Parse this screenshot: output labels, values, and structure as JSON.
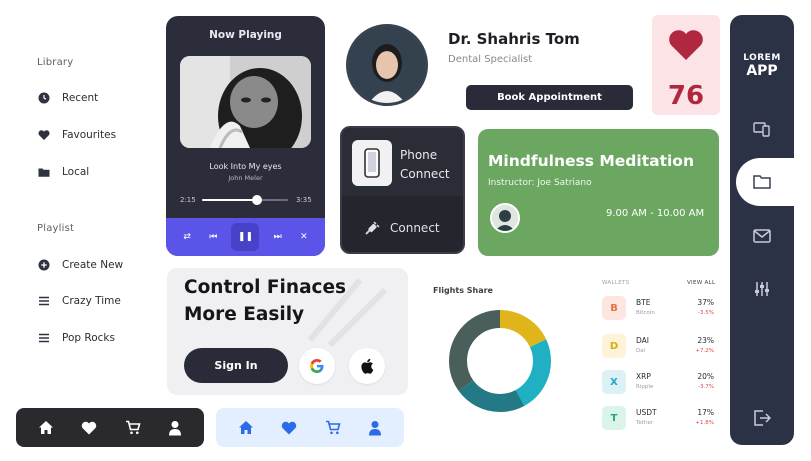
{
  "library": {
    "heading": "Library",
    "items": [
      {
        "label": "Recent",
        "icon": "clock-icon"
      },
      {
        "label": "Favourites",
        "icon": "heart-icon"
      },
      {
        "label": "Local",
        "icon": "folder-icon"
      }
    ]
  },
  "playlist": {
    "heading": "Playlist",
    "items": [
      {
        "label": "Create New",
        "icon": "plus-circle-icon"
      },
      {
        "label": "Crazy Time",
        "icon": "menu-icon"
      },
      {
        "label": "Pop Rocks",
        "icon": "menu-icon"
      }
    ]
  },
  "player": {
    "title": "Now Playing",
    "song": "Look Into My eyes",
    "artist": "John Meler",
    "elapsed": "2:15",
    "duration": "3:35",
    "progress": 0.64,
    "accent": "#5a55e8"
  },
  "doctor": {
    "name": "Dr. Shahris Tom",
    "role": "Dental Specialist",
    "button": "Book Appointment"
  },
  "heart": {
    "value": "76",
    "color": "#b0283f"
  },
  "phone": {
    "label": "Phone Connect",
    "connect": "Connect"
  },
  "meditation": {
    "title": "Mindfulness Meditation",
    "instructor": "Instructor: Joe Satriano",
    "time": "9.00 AM - 10.00 AM",
    "color": "#6ba761"
  },
  "app": {
    "title_line1": "LOREM",
    "title_line2": "APP",
    "color": "#2c3246"
  },
  "finance": {
    "title": "Control Finaces More Easily",
    "signin": "Sign In"
  },
  "flights": {
    "label": "Flights Share"
  },
  "chart_data": {
    "type": "pie",
    "donut": true,
    "title": "Flights Share",
    "slices": [
      {
        "color": "#e0b51c",
        "value": 18
      },
      {
        "color": "#1fb1c3",
        "value": 24
      },
      {
        "color": "#237a86",
        "value": 23
      },
      {
        "color": "#4a5e5c",
        "value": 35
      }
    ]
  },
  "wallets": {
    "heading": "WALLETS",
    "view_all": "VIEW ALL",
    "rows": [
      {
        "symbol": "BTE",
        "name": "Bitcoin",
        "pct": "37%",
        "change": "-3.5%",
        "change_color": "#e04848",
        "icon": "B",
        "bg": "#fde6df",
        "fg": "#e8714a"
      },
      {
        "symbol": "DAI",
        "name": "Dai",
        "pct": "23%",
        "change": "+7.2%",
        "change_color": "#e04848",
        "icon": "D",
        "bg": "#fdf3d6",
        "fg": "#d9a90e"
      },
      {
        "symbol": "XRP",
        "name": "Ripple",
        "pct": "20%",
        "change": "-3.7%",
        "change_color": "#e04848",
        "icon": "X",
        "bg": "#dbf1f6",
        "fg": "#25a4c4"
      },
      {
        "symbol": "USDT",
        "name": "Tether",
        "pct": "17%",
        "change": "+1.8%",
        "change_color": "#e04848",
        "icon": "T",
        "bg": "#dbf4ea",
        "fg": "#25a77c"
      }
    ]
  }
}
